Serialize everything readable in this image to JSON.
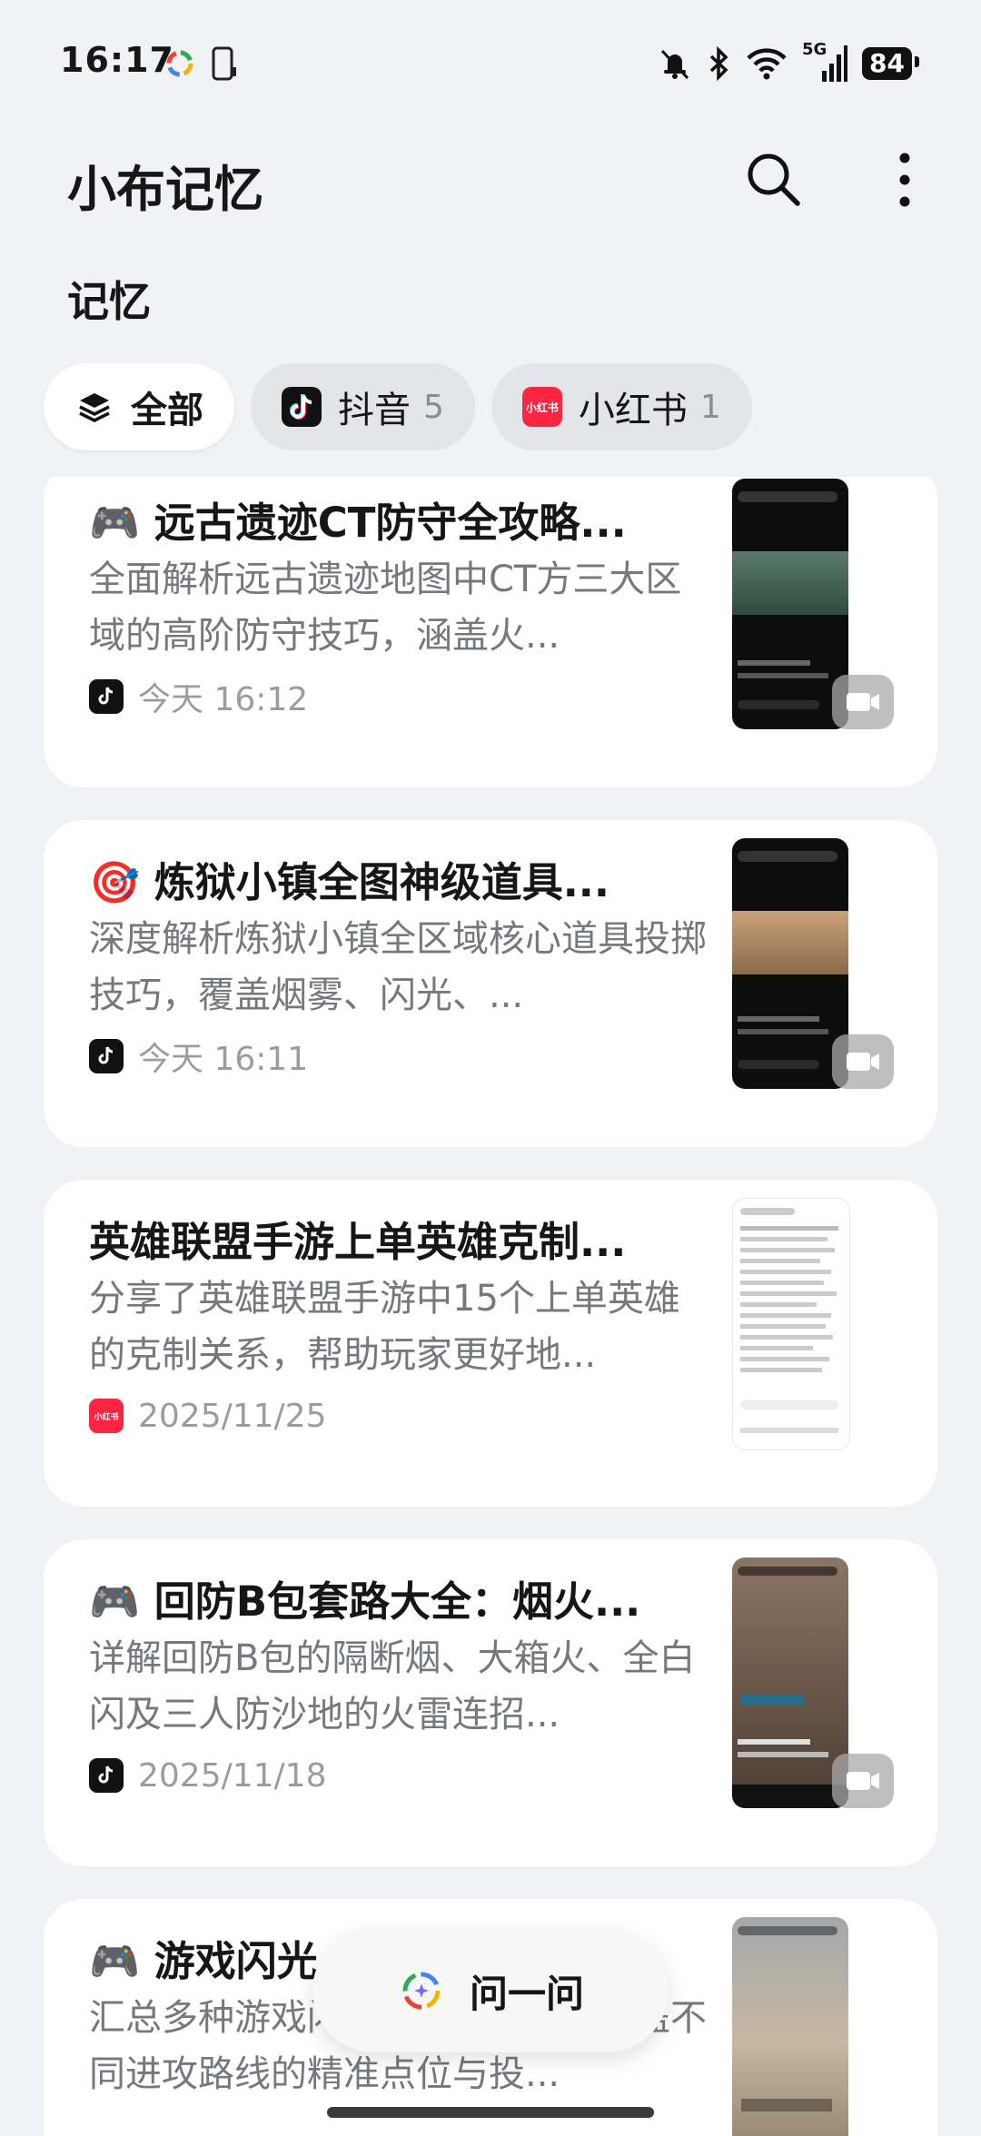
{
  "status_bar": {
    "time": "16:17",
    "network": "5G",
    "battery": "84",
    "icons": [
      "app-spinner-icon",
      "phone-icon",
      "mute-bell-icon",
      "bluetooth-icon",
      "wifi-icon",
      "signal-icon",
      "battery-icon"
    ]
  },
  "header": {
    "title": "小布记忆",
    "icons": [
      "search-icon",
      "more-vertical-icon"
    ]
  },
  "section": {
    "title": "记忆"
  },
  "filters": [
    {
      "label": "全部",
      "count": "",
      "icon": "layers-icon",
      "active": true
    },
    {
      "label": "抖音",
      "count": "5",
      "icon": "douyin-icon",
      "active": false
    },
    {
      "label": "小红书",
      "count": "1",
      "icon": "xiaohongshu-icon",
      "active": false
    }
  ],
  "source_badges": {
    "xhs": "小红书"
  },
  "cards": [
    {
      "title": "🎮 远古遗迹CT防守全攻略...",
      "desc": "全面解析远古遗迹地图中CT方三大区域的高阶防守技巧，涵盖火...",
      "source": "douyin",
      "date": "今天 16:12",
      "video": true
    },
    {
      "title": "🎯 炼狱小镇全图神级道具...",
      "desc": "深度解析炼狱小镇全区域核心道具投掷技巧，覆盖烟雾、闪光、...",
      "source": "douyin",
      "date": "今天 16:11",
      "video": true
    },
    {
      "title": "英雄联盟手游上单英雄克制...",
      "desc": "分享了英雄联盟手游中15个上单英雄的克制关系，帮助玩家更好地...",
      "source": "xiaohongshu",
      "date": "2025/11/25",
      "video": false
    },
    {
      "title": "🎮 回防B包套路大全：烟火...",
      "desc": "详解回防B包的隔断烟、大箱火、全白闪及三人防沙地的火雷连招...",
      "source": "douyin",
      "date": "2025/11/18",
      "video": true
    },
    {
      "title": "🎮 游戏闪光",
      "desc": "汇总多种游戏闪光弹投掷技巧，涵盖不同进攻路线的精准点位与投...",
      "source": "douyin",
      "date": "",
      "video": true
    }
  ],
  "ask_button": {
    "label": "问一问"
  },
  "colors": {
    "background": "#F1F2F5",
    "card": "#FFFFFF",
    "xiaohongshu": "#FF2442",
    "douyin": "#111111"
  }
}
